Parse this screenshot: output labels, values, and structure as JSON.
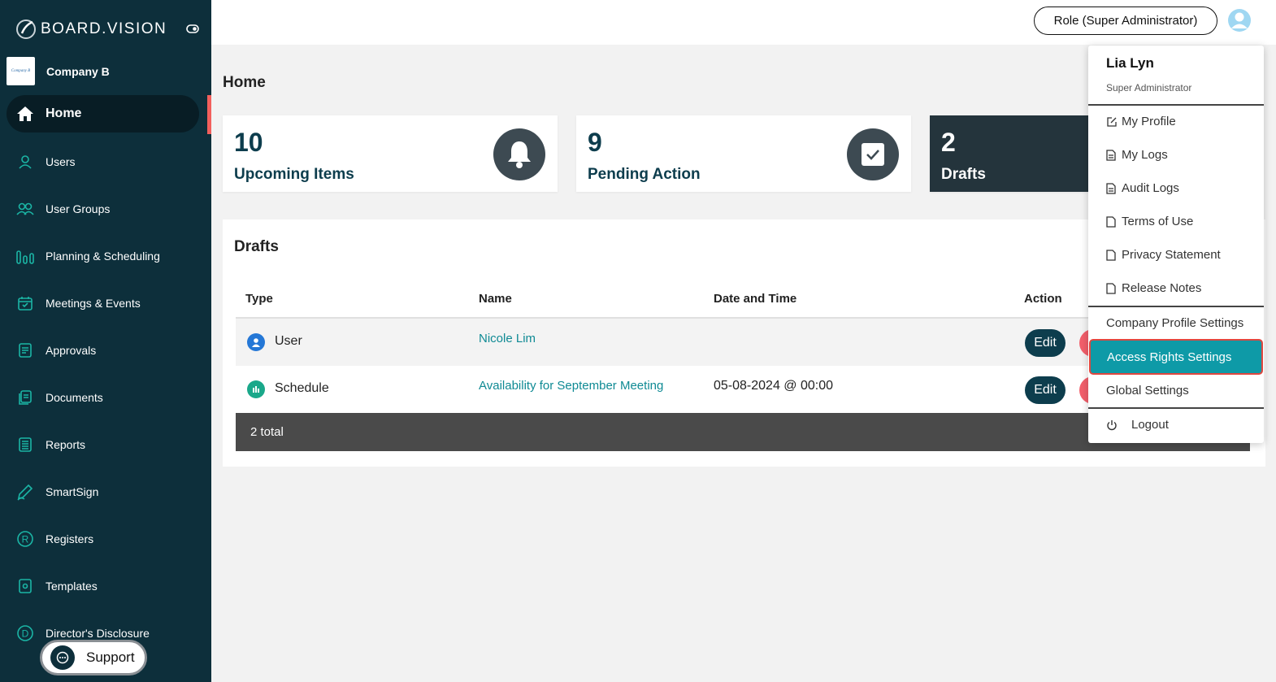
{
  "app": {
    "name": "BOARD.VISION",
    "company_logo_text": "Company B",
    "company_name": "Company B"
  },
  "sidebar": {
    "items": [
      {
        "label": "Home",
        "icon": "home-icon"
      },
      {
        "label": "Users",
        "icon": "user-icon"
      },
      {
        "label": "User Groups",
        "icon": "user-group-icon"
      },
      {
        "label": "Planning & Scheduling",
        "icon": "chart-bars-icon"
      },
      {
        "label": "Meetings & Events",
        "icon": "calendar-icon"
      },
      {
        "label": "Approvals",
        "icon": "approval-icon"
      },
      {
        "label": "Documents",
        "icon": "documents-icon"
      },
      {
        "label": "Reports",
        "icon": "report-icon"
      },
      {
        "label": "SmartSign",
        "icon": "pen-icon"
      },
      {
        "label": "Registers",
        "icon": "registered-icon"
      },
      {
        "label": "Templates",
        "icon": "template-icon"
      },
      {
        "label": "Director's Disclosure",
        "icon": "disclosure-icon"
      }
    ],
    "support_label": "Support"
  },
  "header": {
    "role_label": "Role (Super Administrator)"
  },
  "main": {
    "page_title": "Home",
    "cards": [
      {
        "count": "10",
        "label": "Upcoming Items",
        "icon": "bell-icon"
      },
      {
        "count": "9",
        "label": "Pending Action",
        "icon": "checkbox-icon"
      },
      {
        "count": "2",
        "label": "Drafts",
        "icon": "drafts-icon"
      }
    ],
    "drafts": {
      "title": "Drafts",
      "columns": [
        "Type",
        "Name",
        "Date and Time",
        "Action"
      ],
      "rows": [
        {
          "type": "User",
          "name": "Nicole Lim",
          "datetime": "",
          "edit_label": "Edit"
        },
        {
          "type": "Schedule",
          "name": "Availability for September Meeting",
          "datetime": "05-08-2024 @ 00:00",
          "edit_label": "Edit"
        }
      ],
      "total_label": "2 total"
    }
  },
  "user_menu": {
    "name": "Lia Lyn",
    "role": "Super Administrator",
    "items": [
      {
        "label": "My Profile",
        "icon": "edit-icon"
      },
      {
        "label": "My Logs",
        "icon": "file-text-icon"
      },
      {
        "label": "Audit Logs",
        "icon": "file-text-icon"
      },
      {
        "label": "Terms of Use",
        "icon": "file-icon"
      },
      {
        "label": "Privacy Statement",
        "icon": "file-icon"
      },
      {
        "label": "Release Notes",
        "icon": "file-icon"
      }
    ],
    "settings": [
      "Company Profile Settings",
      "Access Rights Settings",
      "Global Settings"
    ],
    "logout_label": "Logout"
  },
  "colors": {
    "sidebar_bg": "#0d2f3b",
    "accent_teal": "#0e9aa7",
    "danger": "#f25f5c",
    "link": "#0f8a94"
  }
}
